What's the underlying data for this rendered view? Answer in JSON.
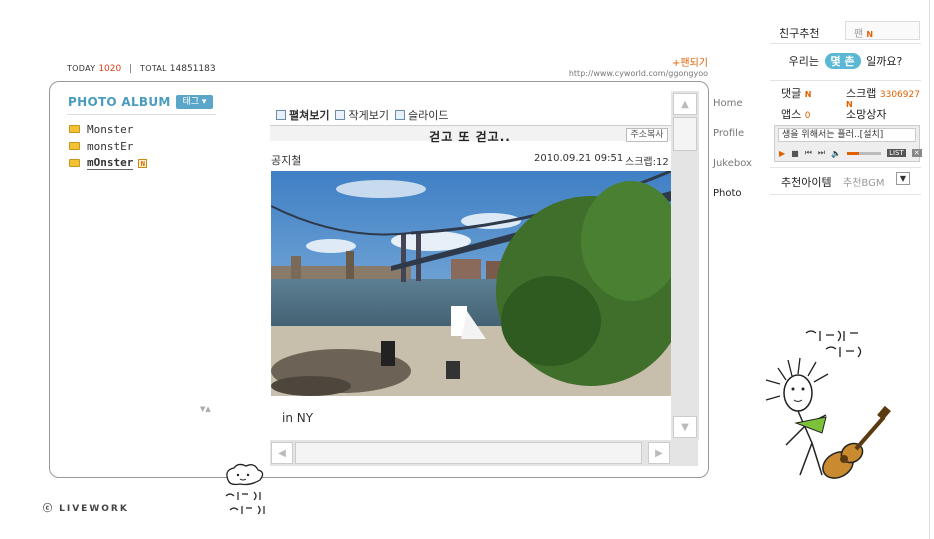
{
  "counter": {
    "today_label": "TODAY",
    "today_value": "1020",
    "total_label": "TOTAL",
    "total_value": "14851183"
  },
  "homepage_url": "http://www.cyworld.com/ggongyoo",
  "fan_join": "+팬되기",
  "album": {
    "title": "PHOTO ALBUM",
    "tag_button": "태그 ▾",
    "folders": [
      {
        "name": "Monster"
      },
      {
        "name": "monstEr"
      },
      {
        "name": "mOnster",
        "badge": "N"
      }
    ]
  },
  "view_tabs": [
    {
      "label": "펼쳐보기",
      "active": true
    },
    {
      "label": "작게보기",
      "active": false
    },
    {
      "label": "슬라이드",
      "active": false
    }
  ],
  "post": {
    "title": "걷고 또 걷고..",
    "copy_button": "주소복사",
    "author": "공지철",
    "date": "2010.09.21 09:51",
    "scrap": "스크랩:12",
    "caption": "in NY"
  },
  "nav": [
    "Home",
    "Profile",
    "Jukebox",
    "Photo"
  ],
  "right_panel": {
    "friend_recommend": "친구추천",
    "fan_label": "팬",
    "fan_badge": "N",
    "relation_prefix": "우리는",
    "relation_pill": "몇 촌",
    "relation_suffix": "일까요?",
    "comments_label": "댓글",
    "comments_badge": "N",
    "scrap_label": "스크랩",
    "scrap_value": "3306927",
    "apps_label": "앱스",
    "apps_value": "0",
    "wish_label": "소망상자",
    "wish_badge": "N",
    "player_text": "생을 위해서는 플러..[설치]",
    "player_list": "LIST",
    "rec_item": "추천아이템",
    "rec_bgm": "추천BGM"
  },
  "footer": {
    "brand": "ⓒ LIVEWORK"
  },
  "handwriting": {
    "cloud": "흘러가는 구름처럼",
    "guitar": "누구나 낭만을 꿈꾸지 나조차도..."
  }
}
